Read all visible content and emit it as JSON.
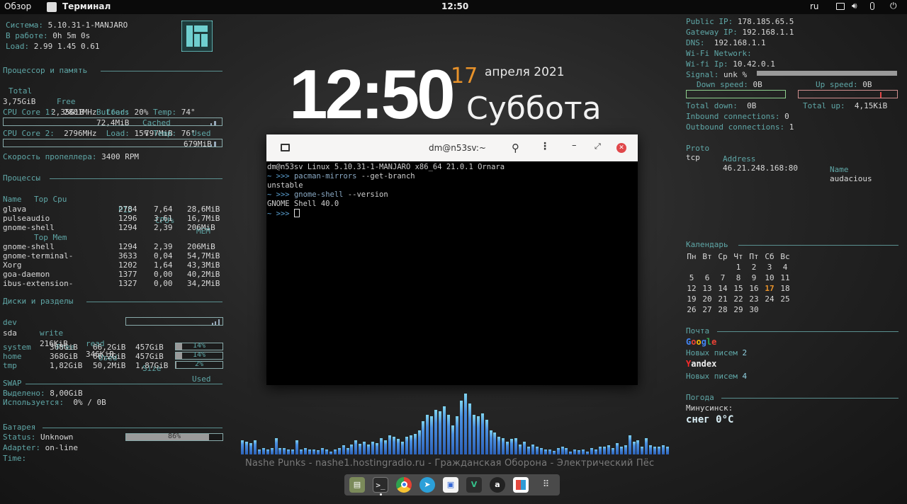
{
  "topbar": {
    "overview": "Обзор",
    "app_name": "Терминал",
    "time": "12:50",
    "lang": "ru"
  },
  "left": {
    "sys_label": "Система:",
    "sys_value": "5.10.31-1-MANJARO",
    "uptime_label": "В работе:",
    "uptime_value": "0h 5m 0s",
    "load_label": "Load:",
    "load_value": "2.99 1.45 0.61",
    "cpu_mem_header": "Процессор и память",
    "mem_headers": [
      "Total",
      "Free",
      "Buffers",
      "Cached",
      "Used"
    ],
    "mem_values": [
      "3,75GiB",
      "2,35GiB",
      "72,4MiB",
      "797MiB",
      "679MiB"
    ],
    "core1": {
      "label": "CPU Core 1:",
      "mhz": "2801MHz",
      "load_label": "Load:",
      "load": "20%",
      "temp_label": "Temp:",
      "temp": "74°"
    },
    "core2": {
      "label": "CPU Core 2:",
      "mhz": "2796MHz",
      "load_label": "Load:",
      "load": "15%",
      "temp_label": "Temp:",
      "temp": "76°"
    },
    "fan_label": "Скорость пропеллера:",
    "fan_value": "3400 RPM",
    "proc_header": "Процессы",
    "proc_cols": [
      "Name",
      "PID",
      "CPU%",
      "MEM"
    ],
    "top_cpu_label": "Top Cpu",
    "top_cpu": [
      [
        "glava",
        "2784",
        "7,64",
        "28,6MiB"
      ],
      [
        "pulseaudio",
        "1296",
        "3,61",
        "16,7MiB"
      ],
      [
        "gnome-shell",
        "1294",
        "2,39",
        "206MiB"
      ]
    ],
    "top_mem_label": "Top Mem",
    "top_mem": [
      [
        "gnome-shell",
        "1294",
        "2,39",
        "206MiB"
      ],
      [
        "gnome-terminal-",
        "3633",
        "0,04",
        "54,7MiB"
      ],
      [
        "Xorg",
        "1202",
        "1,64",
        "43,3MiB"
      ],
      [
        "goa-daemon",
        "1377",
        "0,00",
        "40,2MiB"
      ],
      [
        "ibus-extension-",
        "1327",
        "0,00",
        "34,2MiB"
      ]
    ],
    "disk_header": "Диски и разделы",
    "disk_cols": [
      "dev",
      "write",
      "read"
    ],
    "disk_row": [
      "sda",
      "216KiB",
      "346KiB"
    ],
    "part_cols": [
      "Free",
      "Used",
      "Size",
      "Used"
    ],
    "partitions": [
      {
        "name": "system",
        "free": "368GiB",
        "used": "66,2GiB",
        "size": "457GiB",
        "pct": "14%",
        "frac": 0.14
      },
      {
        "name": "home",
        "free": "368GiB",
        "used": "66,2GiB",
        "size": "457GiB",
        "pct": "14%",
        "frac": 0.14
      },
      {
        "name": "tmp",
        "free": "1,82GiB",
        "used": "50,2MiB",
        "size": "1,87GiB",
        "pct": "2%",
        "frac": 0.02
      }
    ],
    "swap_header": "SWAP",
    "swap_alloc_label": "Выделено:",
    "swap_alloc": "8,00GiB",
    "swap_used_label": "Используется:",
    "swap_used": "0% / 0B",
    "battery_header": "Батарея",
    "status_label": "Status:",
    "status_value": "Unknown",
    "battery_pct": "86%",
    "battery_frac": 0.86,
    "adapter_label": "Adapter:",
    "adapter_value": "on-line",
    "time_label": "Time:"
  },
  "clock": {
    "time": "12:50",
    "day": "17",
    "month_year": "апреля 2021",
    "weekday": "Суббота"
  },
  "terminal": {
    "title": "dm@n53sv:~",
    "lines": [
      {
        "plain": "dm@n53sv Linux 5.10.31-1-MANJARO x86_64 21.0.1 Ornara"
      },
      {
        "prompt": "~ >>> ",
        "cmd": "pacman-mirrors",
        "args": " --get-branch"
      },
      {
        "plain": "unstable"
      },
      {
        "prompt": "~ >>> ",
        "cmd": "gnome-shell",
        "args": " --version"
      },
      {
        "plain": "GNOME Shell 40.0"
      }
    ],
    "last_prompt": "~ >>> "
  },
  "visualizer": {
    "levels": [
      0.22,
      0.2,
      0.18,
      0.22,
      0.08,
      0.1,
      0.08,
      0.1,
      0.26,
      0.1,
      0.1,
      0.08,
      0.08,
      0.22,
      0.08,
      0.1,
      0.08,
      0.08,
      0.07,
      0.1,
      0.08,
      0.05,
      0.08,
      0.1,
      0.14,
      0.1,
      0.16,
      0.22,
      0.17,
      0.2,
      0.16,
      0.2,
      0.18,
      0.26,
      0.22,
      0.3,
      0.28,
      0.24,
      0.2,
      0.28,
      0.3,
      0.32,
      0.38,
      0.52,
      0.62,
      0.6,
      0.7,
      0.68,
      0.76,
      0.62,
      0.46,
      0.6,
      0.84,
      0.96,
      0.8,
      0.62,
      0.6,
      0.64,
      0.54,
      0.38,
      0.34,
      0.28,
      0.26,
      0.2,
      0.24,
      0.26,
      0.16,
      0.2,
      0.12,
      0.16,
      0.12,
      0.1,
      0.08,
      0.08,
      0.06,
      0.1,
      0.12,
      0.1,
      0.05,
      0.08,
      0.07,
      0.08,
      0.05,
      0.1,
      0.08,
      0.12,
      0.12,
      0.14,
      0.1,
      0.18,
      0.12,
      0.14,
      0.3,
      0.2,
      0.22,
      0.12,
      0.26,
      0.14,
      0.12,
      0.12,
      0.14,
      0.12
    ],
    "song": "Nashe Punks - nashe1.hostingradio.ru - Гражданская Оборона - Электрический Пёс"
  },
  "dock": {
    "icons": [
      "files-icon",
      "terminal-icon",
      "chrome-icon",
      "telegram-icon",
      "software-icon",
      "vivaldi-icon",
      "audacious-icon",
      "settings-icon",
      "app-grid-icon"
    ]
  },
  "right": {
    "public_ip_label": "Public IP:",
    "public_ip": "178.185.65.5",
    "gateway_label": "Gateway IP:",
    "gateway": "192.168.1.1",
    "dns_label": "DNS:",
    "dns": "192.168.1.1",
    "wifi_label": "Wi-Fi Network:",
    "wifi_ip_label": "Wi-fi Ip:",
    "wifi_ip": "10.42.0.1",
    "signal_label": "Signal:",
    "signal": "unk %",
    "down_label": "Down speed:",
    "down": "0B",
    "up_label": "Up speed:",
    "up": "0B",
    "total_down_label": "Total down:",
    "total_down": "0B",
    "total_up_label": "Total up:",
    "total_up": "4,15KiB",
    "inbound_label": "Inbound connections:",
    "inbound": "0",
    "outbound_label": "Outbound connections:",
    "outbound": "1",
    "conn_cols": [
      "Proto",
      "Address",
      "Name"
    ],
    "conn_row": [
      "tcp",
      "46.21.248.168:80",
      "audacious"
    ],
    "calendar_header": "Календарь",
    "cal_days": [
      "Пн",
      "Вт",
      "Ср",
      "Чт",
      "Пт",
      "Сб",
      "Вс"
    ],
    "cal_weeks": [
      [
        "",
        "",
        "",
        "1",
        "2",
        "3",
        "4"
      ],
      [
        "5",
        "6",
        "7",
        "8",
        "9",
        "10",
        "11"
      ],
      [
        "12",
        "13",
        "14",
        "15",
        "16",
        "17",
        "18"
      ],
      [
        "19",
        "20",
        "21",
        "22",
        "23",
        "24",
        "25"
      ],
      [
        "26",
        "27",
        "28",
        "29",
        "30",
        "",
        ""
      ]
    ],
    "today": "17",
    "mail_header": "Почта",
    "google": "Google",
    "google_new_label": "Новых писем",
    "google_new": "2",
    "yandex": "Yandex",
    "yandex_new_label": "Новых писем",
    "yandex_new": "4",
    "weather_header": "Погода",
    "city": "Минусинск:",
    "weather": "снег 0°C"
  }
}
